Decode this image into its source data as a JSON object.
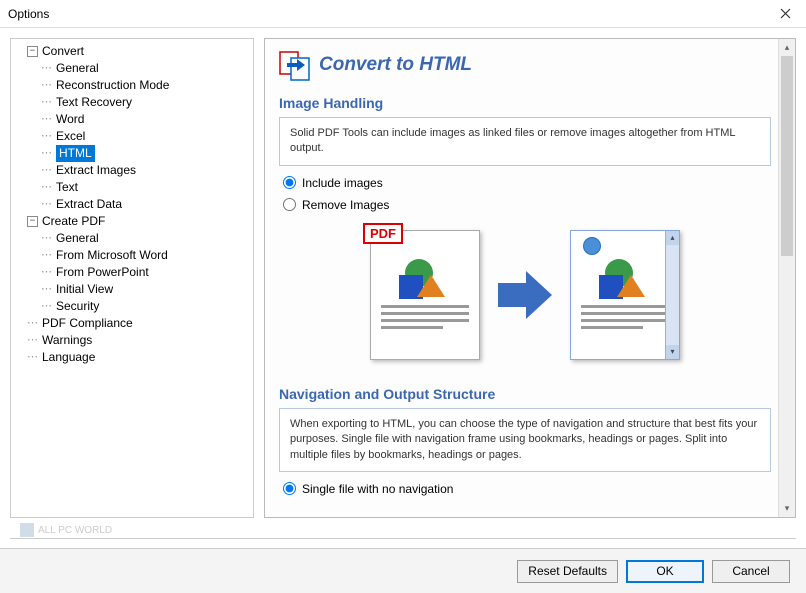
{
  "window": {
    "title": "Options"
  },
  "tree": {
    "convert": {
      "label": "Convert",
      "children": {
        "general": "General",
        "reconstruction": "Reconstruction Mode",
        "recovery": "Text Recovery",
        "word": "Word",
        "excel": "Excel",
        "html": "HTML",
        "extract_images": "Extract Images",
        "text": "Text",
        "extract_data": "Extract Data"
      }
    },
    "create": {
      "label": "Create PDF",
      "children": {
        "general": "General",
        "from_word": "From Microsoft Word",
        "from_ppt": "From PowerPoint",
        "initial_view": "Initial View",
        "security": "Security"
      }
    },
    "compliance": "PDF Compliance",
    "warnings": "Warnings",
    "language": "Language"
  },
  "page": {
    "title": "Convert to HTML",
    "section1": {
      "title": "Image Handling",
      "desc": "Solid PDF Tools can include images as linked files or remove images altogether from HTML output.",
      "opt_include": "Include images",
      "opt_remove": "Remove Images"
    },
    "pdf_badge": "PDF",
    "section2": {
      "title": "Navigation and Output Structure",
      "desc": "When exporting to HTML, you can choose the type of navigation and structure that best fits your purposes. Single file with navigation frame using bookmarks, headings or pages. Split into multiple files by bookmarks, headings or pages.",
      "opt_single": "Single file with no navigation"
    }
  },
  "buttons": {
    "reset": "Reset Defaults",
    "ok": "OK",
    "cancel": "Cancel"
  },
  "watermark": "ALL PC WORLD"
}
